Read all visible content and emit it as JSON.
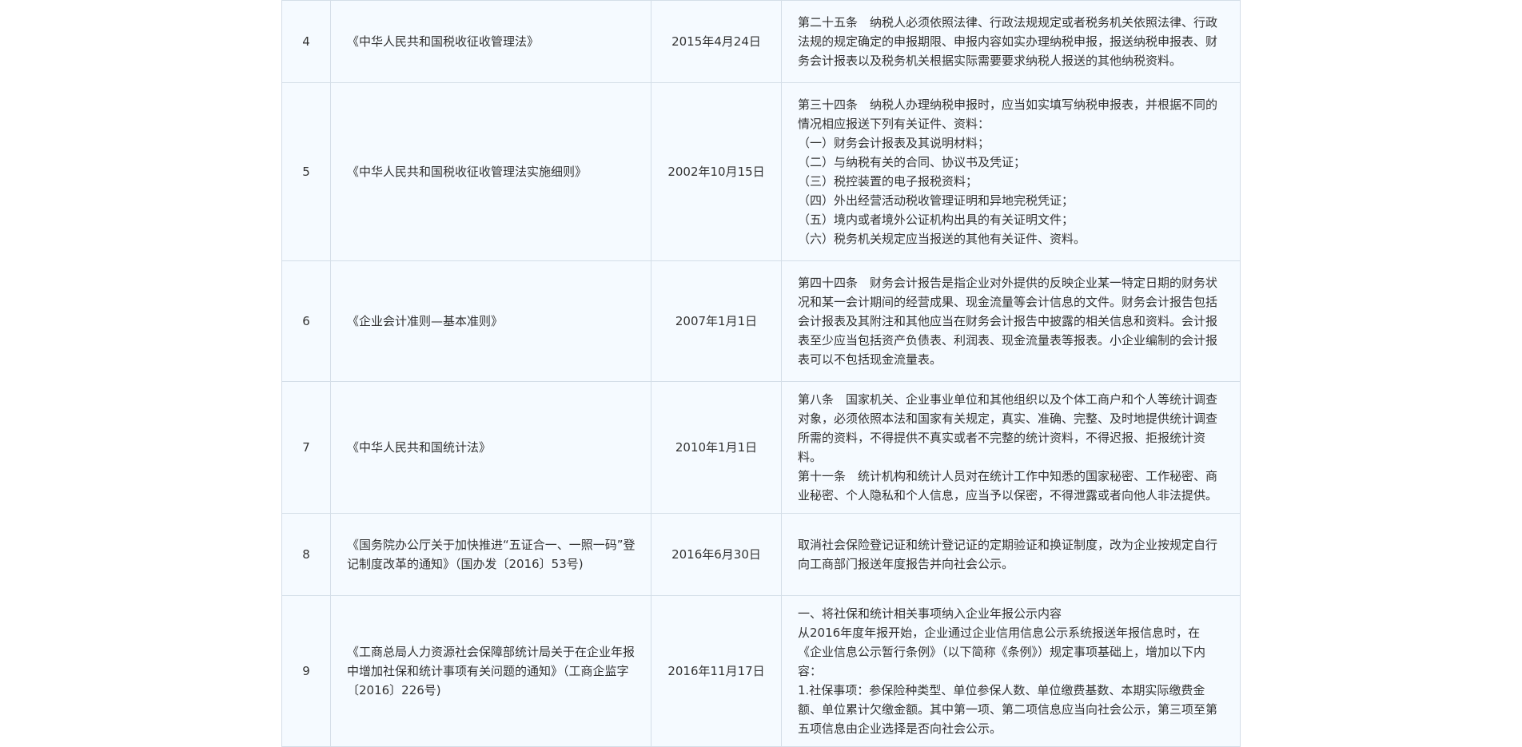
{
  "rows": [
    {
      "no": "4",
      "name": "《中华人民共和国税收征收管理法》",
      "date": "2015年4月24日",
      "content": [
        "第二十五条　纳税人必须依照法律、行政法规规定或者税务机关依照法律、行政法规的规定确定的申报期限、申报内容如实办理纳税申报，报送纳税申报表、财务会计报表以及税务机关根据实际需要要求纳税人报送的其他纳税资料。"
      ]
    },
    {
      "no": "5",
      "name": "《中华人民共和国税收征收管理法实施细则》",
      "date": "2002年10月15日",
      "content": [
        "第三十四条　纳税人办理纳税申报时，应当如实填写纳税申报表，并根据不同的情况相应报送下列有关证件、资料：",
        "（一）财务会计报表及其说明材料；",
        "（二）与纳税有关的合同、协议书及凭证；",
        "（三）税控装置的电子报税资料；",
        "（四）外出经营活动税收管理证明和异地完税凭证；",
        "（五）境内或者境外公证机构出具的有关证明文件；",
        "（六）税务机关规定应当报送的其他有关证件、资料。"
      ]
    },
    {
      "no": "6",
      "name": "《企业会计准则—基本准则》",
      "date": "2007年1月1日",
      "content": [
        "第四十四条　财务会计报告是指企业对外提供的反映企业某一特定日期的财务状况和某一会计期间的经营成果、现金流量等会计信息的文件。财务会计报告包括会计报表及其附注和其他应当在财务会计报告中披露的相关信息和资料。会计报表至少应当包括资产负债表、利润表、现金流量表等报表。小企业编制的会计报表可以不包括现金流量表。"
      ]
    },
    {
      "no": "7",
      "name": "《中华人民共和国统计法》",
      "date": "2010年1月1日",
      "content": [
        "第八条　国家机关、企业事业单位和其他组织以及个体工商户和个人等统计调查对象，必须依照本法和国家有关规定，真实、准确、完整、及时地提供统计调查所需的资料，不得提供不真实或者不完整的统计资料，不得迟报、拒报统计资料。",
        "第十一条　统计机构和统计人员对在统计工作中知悉的国家秘密、工作秘密、商业秘密、个人隐私和个人信息，应当予以保密，不得泄露或者向他人非法提供。"
      ]
    },
    {
      "no": "8",
      "name": "《国务院办公厅关于加快推进“五证合一、一照一码”登记制度改革的通知》（国办发〔2016〕53号)",
      "date": "2016年6月30日",
      "content": [
        "取消社会保险登记证和统计登记证的定期验证和换证制度，改为企业按规定自行向工商部门报送年度报告并向社会公示。"
      ]
    },
    {
      "no": "9",
      "name": "《工商总局人力资源社会保障部统计局关于在企业年报中增加社保和统计事项有关问题的通知》（工商企监字〔2016〕226号)",
      "date": "2016年11月17日",
      "content": [
        "一、将社保和统计相关事项纳入企业年报公示内容",
        "从2016年度年报开始，企业通过企业信用信息公示系统报送年报信息时，在《企业信息公示暂行条例》（以下简称《条例》）规定事项基础上，增加以下内容：",
        "1.社保事项：参保险种类型、单位参保人数、单位缴费基数、本期实际缴费金额、单位累计欠缴金额。其中第一项、第二项信息应当向社会公示，第三项至第五项信息由企业选择是否向社会公示。"
      ]
    }
  ]
}
